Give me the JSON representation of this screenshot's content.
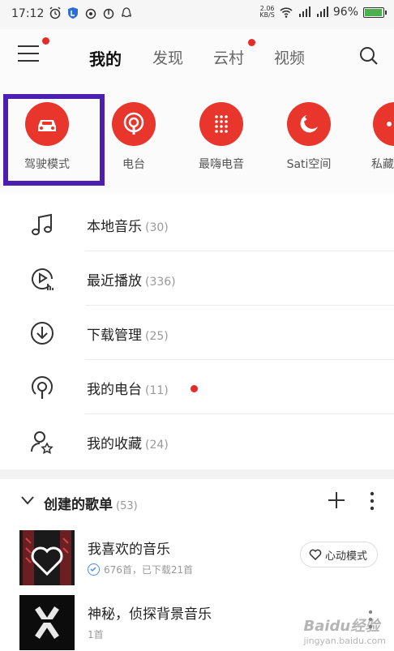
{
  "status": {
    "time": "17:12",
    "speed_top": "2.06",
    "speed_bottom": "KB/S",
    "battery": "96%",
    "battery_level": 0.96
  },
  "nav": {
    "tabs": [
      {
        "label": "我的"
      },
      {
        "label": "发现"
      },
      {
        "label": "云村"
      },
      {
        "label": "视频"
      }
    ]
  },
  "quick": [
    {
      "label": "驾驶模式",
      "icon": "car-icon"
    },
    {
      "label": "电台",
      "icon": "radio-icon"
    },
    {
      "label": "最嗨电音",
      "icon": "dots-icon"
    },
    {
      "label": "Sati空间",
      "icon": "moon-icon"
    },
    {
      "label": "私藏",
      "icon": "private-icon"
    }
  ],
  "list": [
    {
      "label": "本地音乐",
      "count": "(30)",
      "icon": "music-note-icon"
    },
    {
      "label": "最近播放",
      "count": "(336)",
      "icon": "recent-play-icon"
    },
    {
      "label": "下载管理",
      "count": "(25)",
      "icon": "download-icon"
    },
    {
      "label": "我的电台",
      "count": "(11)",
      "icon": "podcast-icon"
    },
    {
      "label": "我的收藏",
      "count": "(24)",
      "icon": "collection-icon"
    }
  ],
  "playlists": {
    "title": "创建的歌单",
    "count": "(53)",
    "items": [
      {
        "title": "我喜欢的音乐",
        "sub": "676首，已下载21首",
        "action": "心动模式"
      },
      {
        "title": "神秘，侦探背景音乐",
        "sub": "1首"
      }
    ]
  },
  "watermark": {
    "main": "Baidu经验",
    "sub": "jingyan.baidu.com"
  },
  "colors": {
    "accent": "#e8362c",
    "highlight": "#4b1fb0"
  }
}
